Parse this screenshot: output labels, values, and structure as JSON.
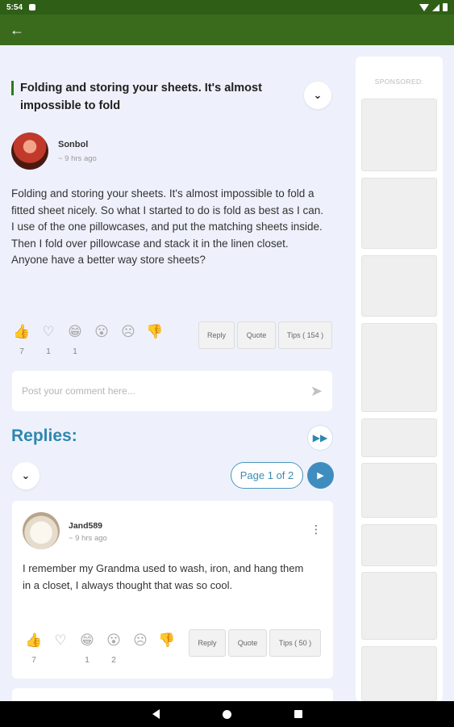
{
  "status": {
    "time": "5:54"
  },
  "post": {
    "title": "Folding and storing your sheets. It's almost impossible to fold",
    "author": "Sonbol",
    "time": "~ 9 hrs ago",
    "body": "Folding and storing your sheets. It's almost impossible to fold a fitted sheet nicely. So what I started to do is fold as best as I can.\nI use of the one pillowcases, and put the matching sheets inside. Then I fold over pillowcase and stack it in the linen closet. Anyone have a better way store sheets?",
    "reactions": [
      {
        "icon": "thumbs-up-icon",
        "glyph": "👍",
        "count": "7"
      },
      {
        "icon": "heart-icon",
        "glyph": "♡",
        "count": "1"
      },
      {
        "icon": "grin-icon",
        "glyph": "😁",
        "count": "1"
      },
      {
        "icon": "surprised-icon",
        "glyph": "😮",
        "count": ""
      },
      {
        "icon": "sad-icon",
        "glyph": "☹",
        "count": ""
      },
      {
        "icon": "thumbs-down-icon",
        "glyph": "👎",
        "count": ""
      }
    ],
    "buttons": {
      "reply": "Reply",
      "quote": "Quote",
      "tips": "Tips ( 154 )"
    }
  },
  "comment": {
    "placeholder": "Post your comment here..."
  },
  "replies": {
    "title": "Replies:",
    "page_label": "Page 1 of 2",
    "items": [
      {
        "author": "Jand589",
        "time": "~ 9 hrs ago",
        "body": "I remember my Grandma used to wash, iron, and hang them in a closet, I always thought that was so cool.",
        "reactions": [
          {
            "icon": "thumbs-up-icon",
            "glyph": "👍",
            "count": "7"
          },
          {
            "icon": "heart-icon",
            "glyph": "♡",
            "count": ""
          },
          {
            "icon": "grin-icon",
            "glyph": "😁",
            "count": "1"
          },
          {
            "icon": "surprised-icon",
            "glyph": "😮",
            "count": "2"
          },
          {
            "icon": "sad-icon",
            "glyph": "☹",
            "count": ""
          },
          {
            "icon": "thumbs-down-icon",
            "glyph": "👎",
            "count": ""
          }
        ],
        "buttons": {
          "reply": "Reply",
          "quote": "Quote",
          "tips": "Tips ( 50 )"
        }
      }
    ]
  },
  "sidebar": {
    "label": "SPONSORED:"
  },
  "colors": {
    "appbar": "#3a6b1d",
    "accent": "#2d87b0",
    "title_bar": "#2f7a1f"
  }
}
